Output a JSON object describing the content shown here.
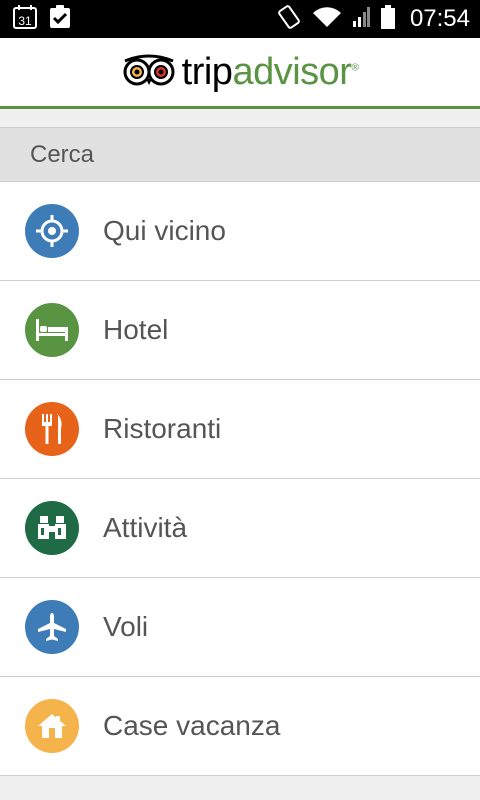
{
  "status_bar": {
    "time": "07:54",
    "calendar_day": "31"
  },
  "header": {
    "logo_part1": "trip",
    "logo_part2": "advisor"
  },
  "section": {
    "title": "Cerca"
  },
  "menu": [
    {
      "label": "Qui vicino",
      "icon": "target-icon",
      "color": "#3e7cb8"
    },
    {
      "label": "Hotel",
      "icon": "bed-icon",
      "color": "#589442"
    },
    {
      "label": "Ristoranti",
      "icon": "fork-knife-icon",
      "color": "#e8631a"
    },
    {
      "label": "Attività",
      "icon": "binoculars-icon",
      "color": "#1f6b45"
    },
    {
      "label": "Voli",
      "icon": "airplane-icon",
      "color": "#3e7cb8"
    },
    {
      "label": "Case vacanza",
      "icon": "house-icon",
      "color": "#f5b44b"
    }
  ]
}
